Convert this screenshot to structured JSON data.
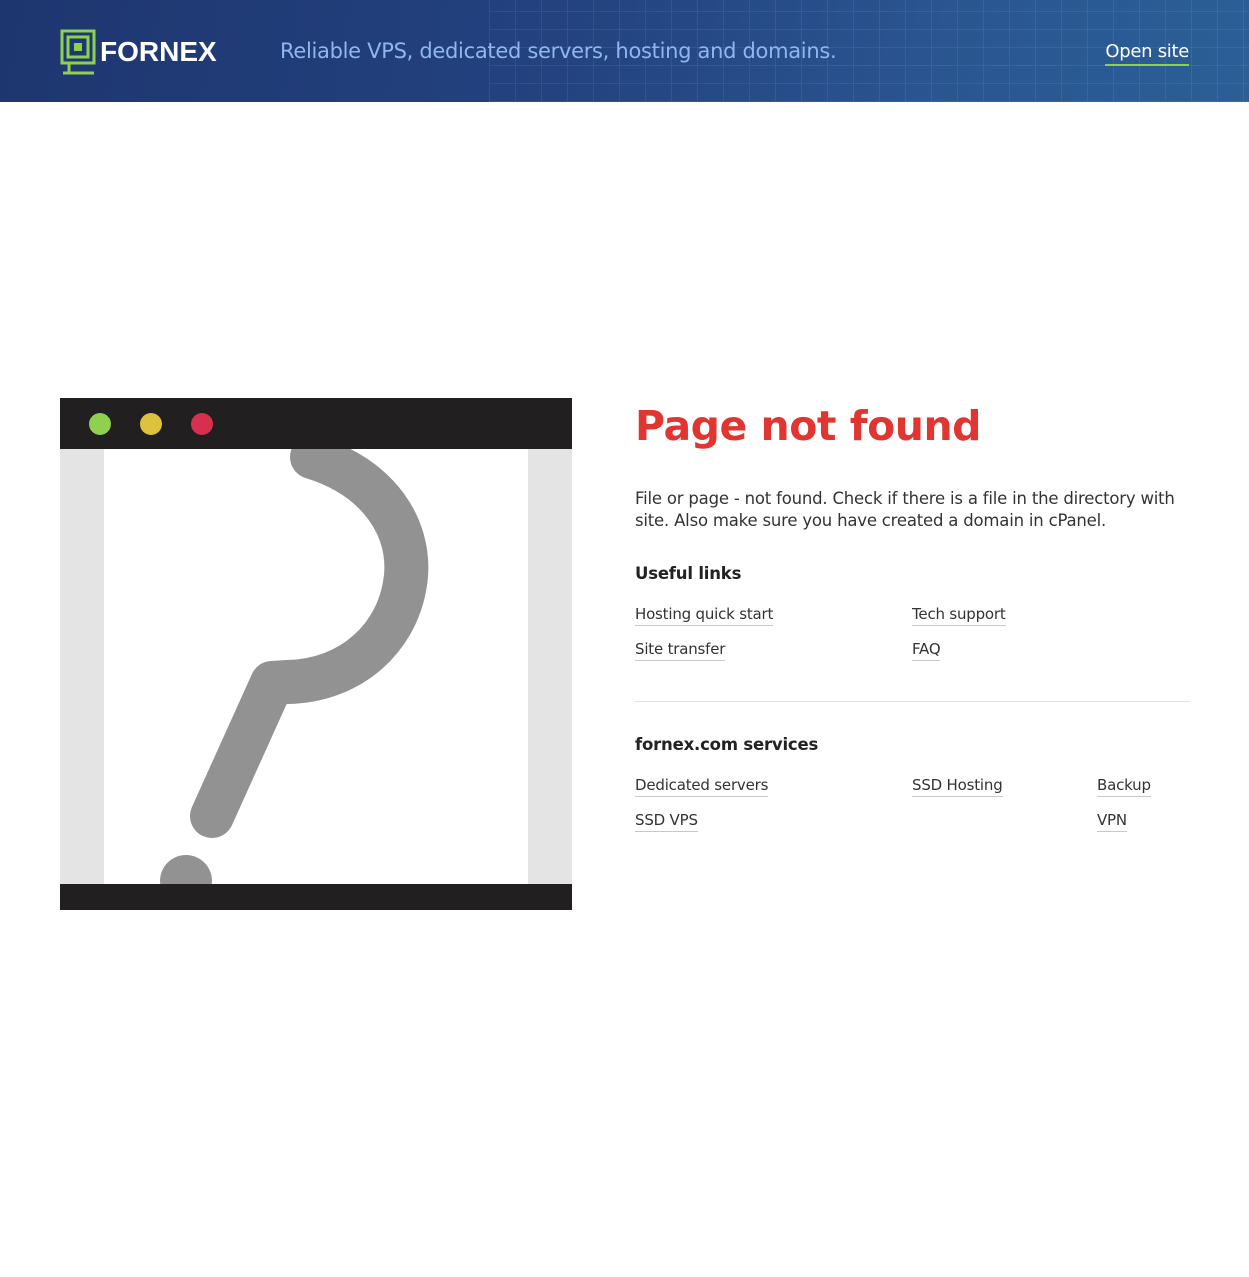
{
  "header": {
    "logo_text": "FORNEX",
    "tagline": "Reliable VPS, dedicated servers, hosting and domains.",
    "open_site_label": "Open site",
    "colors": {
      "background": "#23427f",
      "tagline": "#8fb7ee",
      "accent": "#8fd14f"
    }
  },
  "illustration": {
    "window_dots": [
      "#8fd14f",
      "#ddc23f",
      "#d6304e"
    ],
    "icon": "question-mark-browser-icon"
  },
  "main": {
    "title": "Page not found",
    "description": "File or page - not found. Check if there is a file in the directory with site. Also make sure you have created a domain in cPanel.",
    "useful_links": {
      "title": "Useful links",
      "items": [
        {
          "label": "Hosting quick start"
        },
        {
          "label": "Tech support"
        },
        {
          "label": "Site transfer"
        },
        {
          "label": "FAQ"
        }
      ]
    },
    "services": {
      "title": "fornex.com services",
      "items": [
        {
          "label": "Dedicated servers"
        },
        {
          "label": "SSD Hosting"
        },
        {
          "label": "Backup"
        },
        {
          "label": "SSD VPS"
        },
        {
          "label": "VPN"
        }
      ]
    },
    "colors": {
      "title": "#e03530"
    }
  }
}
